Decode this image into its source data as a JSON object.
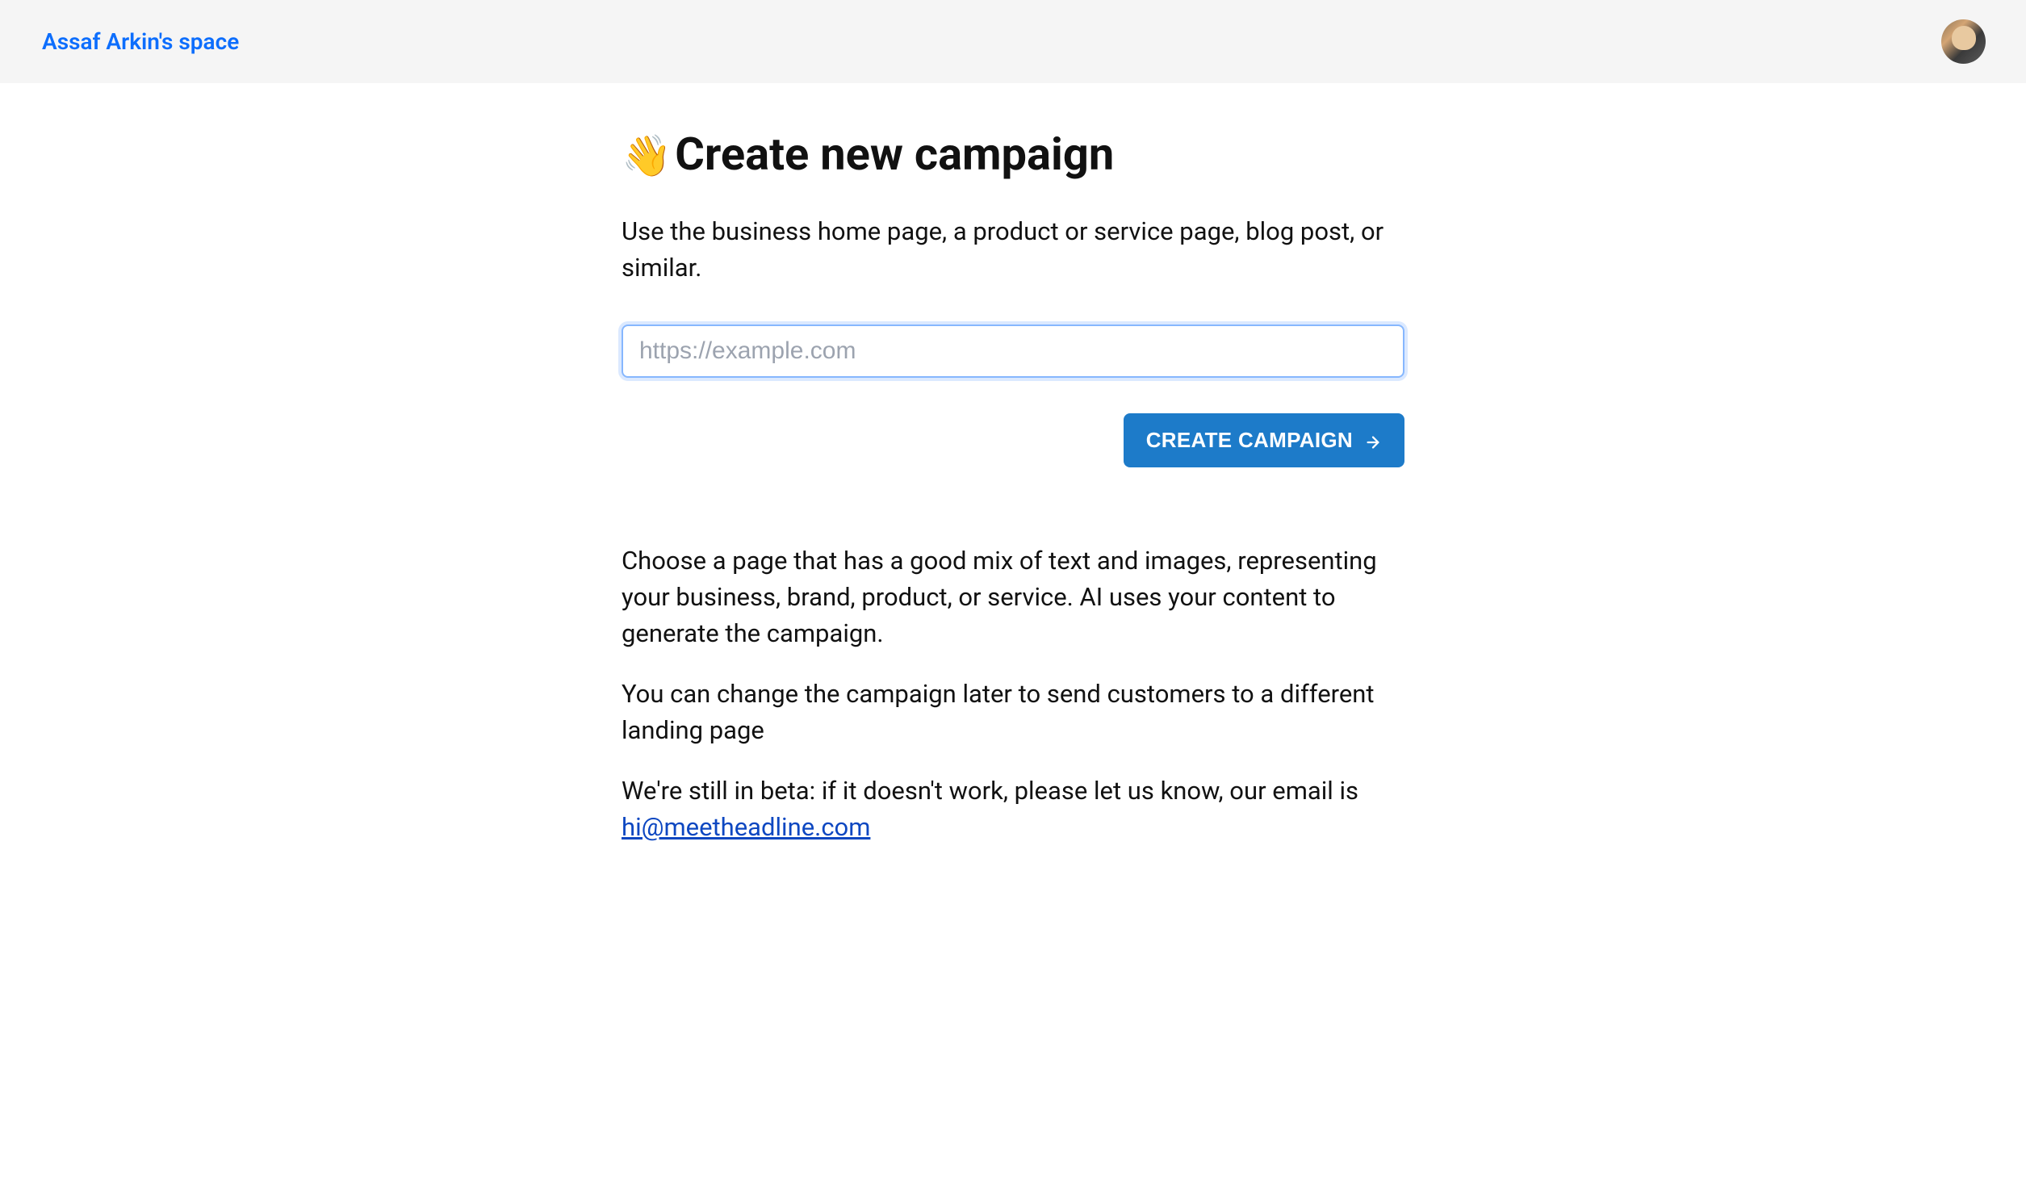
{
  "header": {
    "workspace_name": "Assaf Arkin's space"
  },
  "main": {
    "wave_emoji": "👋",
    "title": "Create new campaign",
    "subtitle": "Use the business home page, a product or service page, blog post, or similar.",
    "url_input": {
      "placeholder": "https://example.com",
      "value": ""
    },
    "create_button_label": "CREATE CAMPAIGN",
    "help_paragraphs": {
      "p1": "Choose a page that has a good mix of text and images, representing your business, brand, product, or service. AI uses your content to generate the campaign.",
      "p2": "You can change the campaign later to send customers to a different landing page",
      "p3_prefix": "We're still in beta: if it doesn't work, please let us know, our email is ",
      "email": "hi@meetheadline.com"
    }
  }
}
